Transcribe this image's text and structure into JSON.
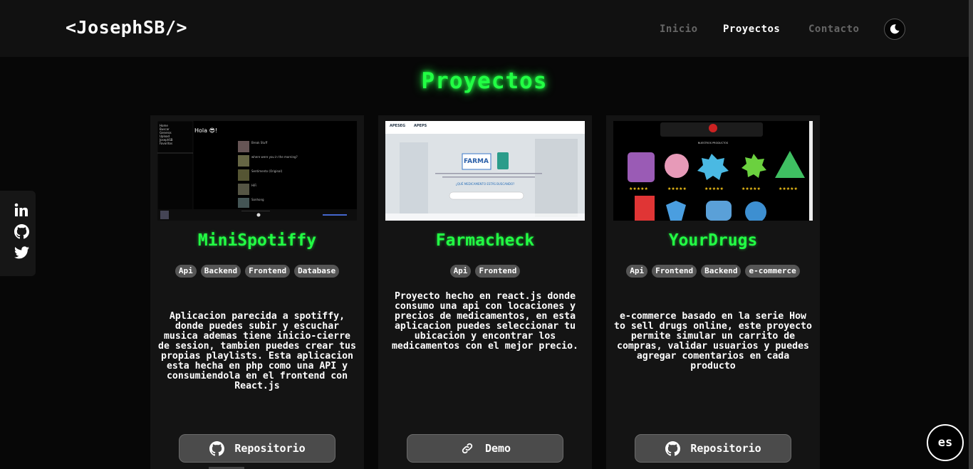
{
  "header": {
    "logo": "<JosephSB/>",
    "nav": [
      "Inicio",
      "Proyectos",
      "Contacto"
    ],
    "active_nav": "Proyectos",
    "theme_icon": "moon-icon"
  },
  "page": {
    "title": "Proyectos",
    "accent_color": "#22ff44"
  },
  "social": [
    "linkedin-icon",
    "github-icon",
    "twitter-icon"
  ],
  "projects": [
    {
      "name": "MiniSpotiffy",
      "tags": [
        "Api",
        "Backend",
        "Frontend",
        "Database"
      ],
      "description": "Aplicacion parecida a spotiffy, donde puedes subir y escuchar musica ademas tiene inicio-cierre de sesion, tambien puedes crear tus propias playlists. Esta aplicacion esta hecha en php como una API y consumiendola en el frontend con React.js",
      "button": "Repositorio",
      "button_icon": "github-icon",
      "screenshot": {
        "greeting": "Hola 😎!",
        "menu": [
          "Home",
          "Buscar",
          "Generos",
          "Upload",
          "JosephSB",
          "Favoritos"
        ],
        "tracks": [
          "Break Stuff",
          "where were you in the morning?",
          "Sentimento (Original)",
          "HiFi",
          "Sonhong"
        ]
      }
    },
    {
      "name": "Farmacheck",
      "tags": [
        "Api",
        "Frontend"
      ],
      "description": "Proyecto hecho en react.js donde consumo una api con locaciones y precios de medicamentos, en esta aplicacion puedes seleccionar tu ubicacion y encontrar los medicamentos con el mejor precio.",
      "button": "Demo",
      "button_icon": "link-icon",
      "screenshot": {
        "logos": [
          "APESEG",
          "APEPS"
        ],
        "brand": "FARMA",
        "question": "¿QUÉ MEDICAMENTO ESTÁS BUSCANDO?"
      }
    },
    {
      "name": "YourDrugs",
      "tags": [
        "Api",
        "Frontend",
        "Backend",
        "e-commerce"
      ],
      "description": "e-commerce basado en la serie How to sell drugs online, este proyecto permite simular un carrito de compras, validar usuarios y puedes agregar comentarios en cada producto",
      "button": "Repositorio",
      "button_icon": "github-icon",
      "screenshot": {
        "heading": "NUESTROS PRODUCTOS",
        "rating": "★★★★★"
      }
    }
  ],
  "lang_button": "es"
}
